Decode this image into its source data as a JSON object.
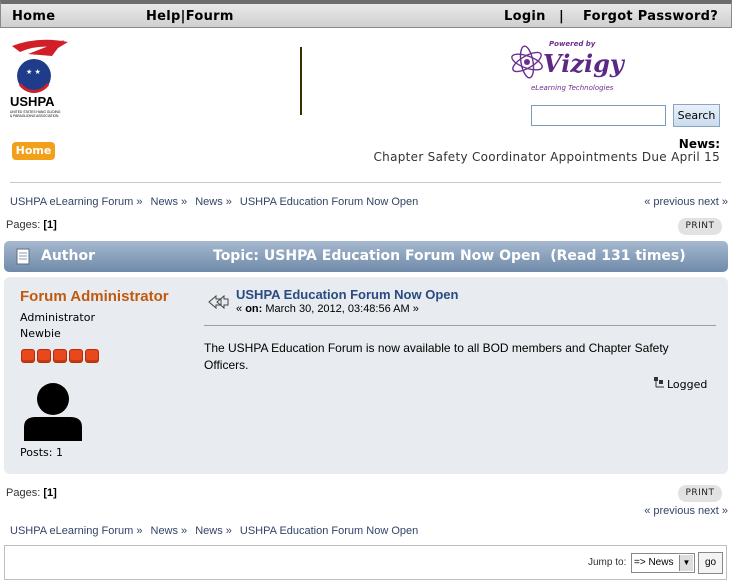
{
  "topbar": {
    "home": "Home",
    "help": "Help|Fourm",
    "login": "Login",
    "separator": "|",
    "forgot": "Forgot Password?"
  },
  "header": {
    "logo_text": "USHPA",
    "logo_subtext": "UNITED STATES HANG GLIDING & PARAGLIDING ASSOCIATION",
    "vizigy_powered": "Powered by",
    "vizigy_name": "Vizigy",
    "vizigy_tag": "eLearning Technologies",
    "search_button": "Search",
    "search_value": "",
    "home_button": "Home",
    "news_label": "News:",
    "news_text": "Chapter Safety Coordinator Appointments Due April 15"
  },
  "breadcrumb": {
    "items": [
      "USHPA eLearning Forum",
      "News",
      "News",
      "USHPA Education Forum Now Open"
    ],
    "arrow": "»",
    "prevnext": "« previous next »"
  },
  "pagination": {
    "label": "Pages:",
    "current": "[1]",
    "print": "PRINT"
  },
  "topic_header": {
    "author": "Author",
    "topic": "Topic: USHPA Education Forum Now Open  (Read 131 times)"
  },
  "post": {
    "poster_name": "Forum Administrator",
    "poster_role": "Administrator",
    "poster_rank": "Newbie",
    "stars": 5,
    "posts_count": "Posts: 1",
    "title": "USHPA Education Forum Now Open",
    "date_prefix": "« ",
    "date_on": "on:",
    "date": " March 30, 2012, 03:48:56 AM »",
    "body": "The USHPA Education Forum is now available to all BOD members and Chapter Safety Officers.",
    "logged": "Logged"
  },
  "jump": {
    "label": "Jump to:",
    "selected": "=> News",
    "go": "go"
  },
  "colors": {
    "accent_orange": "#f29f19",
    "poster_name": "#c05a0e",
    "link": "#2a4a82",
    "header_bar": "#7d96b3"
  }
}
